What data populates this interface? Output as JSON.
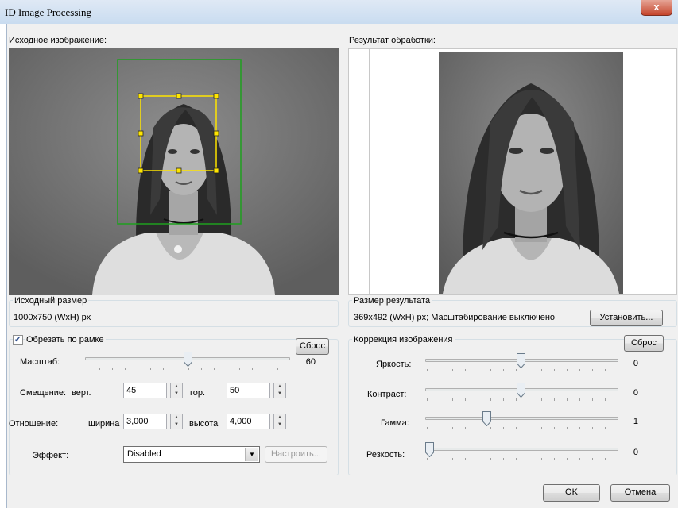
{
  "window": {
    "title": "ID Image Processing",
    "close_glyph": "x"
  },
  "source_image": {
    "label": "Исходное изображение:"
  },
  "result_image": {
    "label": "Результат обработки:"
  },
  "source_size": {
    "caption": "Исходный размер",
    "value": "1000x750 (WxH) px"
  },
  "result_size": {
    "caption": "Размер результата",
    "value": "369x492 (WxH) px; Масштабирование выключено",
    "set_button": "Установить..."
  },
  "crop": {
    "checkbox_label": "Обрезать по рамке",
    "checked": true,
    "reset_button": "Сброс",
    "scale_label": "Масштаб:",
    "scale_value": "60",
    "offset_label": "Смещение:",
    "vert_label": "верт.",
    "vert_value": "45",
    "horiz_label": "гор.",
    "horiz_value": "50",
    "ratio_label": "Отношение:",
    "width_label": "ширина",
    "width_value": "3,000",
    "height_label": "высота",
    "height_value": "4,000",
    "effect_label": "Эффект:",
    "effect_value": "Disabled",
    "configure_button": "Настроить..."
  },
  "correction": {
    "caption": "Коррекция изображения",
    "reset_button": "Сброс",
    "brightness_label": "Яркость:",
    "brightness_value": "0",
    "contrast_label": "Контраст:",
    "contrast_value": "0",
    "gamma_label": "Гамма:",
    "gamma_value": "1",
    "sharpness_label": "Резкость:",
    "sharpness_value": "0"
  },
  "footer": {
    "ok_button": "OK",
    "cancel_button": "Отмена"
  }
}
